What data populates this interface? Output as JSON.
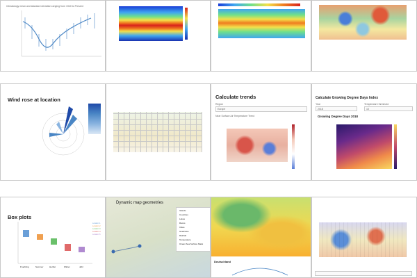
{
  "cards": [
    {
      "id": "climatology",
      "title": "Climatology mean and standard deviation ranging from 1940 to Present"
    },
    {
      "id": "temperature-map",
      "title": "Near Surface Air Temperature"
    },
    {
      "id": "temperature-bands",
      "title": ""
    },
    {
      "id": "anomaly-map",
      "title": ""
    },
    {
      "id": "wind-rose",
      "title": "Wind rose at location"
    },
    {
      "id": "projection-grid",
      "title": ""
    },
    {
      "id": "trends",
      "title": "Calculate trends",
      "region_label": "Region",
      "region_value": "Europe",
      "map_title": "Near Surface Air Temperature Trend"
    },
    {
      "id": "gdd",
      "title": "Calculate Growing Degree Days Index",
      "map_title": "Growing Degree Days 2018",
      "field1": "Year",
      "field1_value": "2018",
      "field2": "Temperature threshold",
      "field2_value": "10"
    },
    {
      "id": "box-plots",
      "title": "Box plots"
    },
    {
      "id": "dynamic-geometries",
      "title": "Dynamic map geometries",
      "layers": [
        "Islands",
        "Countries",
        "Lakes",
        "Rivers",
        "Cities",
        "Graticules",
        "Rainfall",
        "Temperature",
        "Ocean Sea Surface Mask"
      ]
    },
    {
      "id": "europe-map",
      "title": "",
      "sub_title": "Deutschland"
    },
    {
      "id": "anomaly-map-2",
      "title": ""
    }
  ],
  "box_legend": [
    "Location 1",
    "Location 2",
    "Location 3",
    "Location 4",
    "Location 5"
  ],
  "box_axis": [
    "Fruehling",
    "Sommer",
    "Herbst",
    "Winter",
    "Jahr"
  ],
  "colors": {
    "card_border": "#c8c8c8",
    "line": "#4a86c5"
  }
}
